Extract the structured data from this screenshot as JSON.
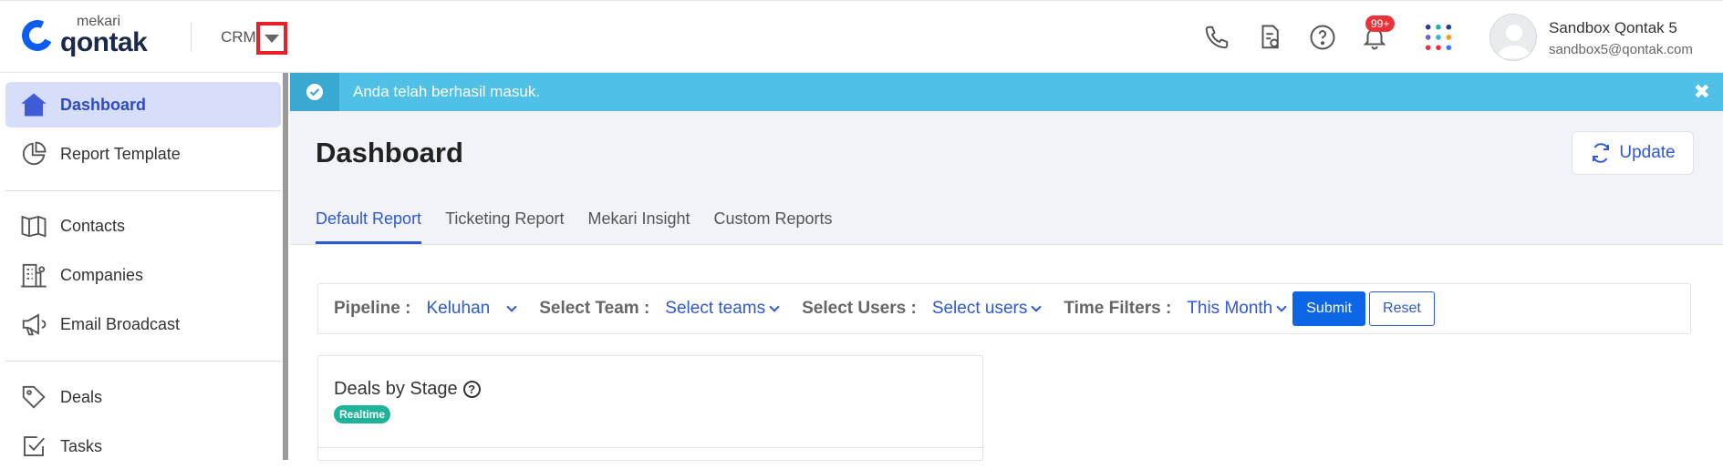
{
  "header": {
    "logo_small": "mekari",
    "logo_big": "qontak",
    "module": "CRM",
    "notification_count": "99+",
    "user_name": "Sandbox Qontak 5",
    "user_email": "sandbox5@qontak.com"
  },
  "sidebar": {
    "items": [
      {
        "label": "Dashboard",
        "icon": "home-icon",
        "active": true
      },
      {
        "label": "Report Template",
        "icon": "pie-chart-icon"
      },
      {
        "label": "Contacts",
        "icon": "book-icon"
      },
      {
        "label": "Companies",
        "icon": "building-icon"
      },
      {
        "label": "Email Broadcast",
        "icon": "megaphone-icon"
      },
      {
        "label": "Deals",
        "icon": "tag-icon"
      },
      {
        "label": "Tasks",
        "icon": "checkbox-icon"
      }
    ]
  },
  "alert": {
    "message": "Anda telah berhasil masuk.",
    "close": "✖"
  },
  "page": {
    "title": "Dashboard",
    "update_label": "Update"
  },
  "tabs": [
    "Default Report",
    "Ticketing Report",
    "Mekari Insight",
    "Custom Reports"
  ],
  "filters": {
    "pipeline_label": "Pipeline :",
    "pipeline_value": "Keluhan",
    "team_label": "Select Team :",
    "team_value": "Select teams",
    "users_label": "Select Users :",
    "users_value": "Select users",
    "time_label": "Time Filters :",
    "time_value": "This Month",
    "submit": "Submit",
    "reset": "Reset"
  },
  "card": {
    "title": "Deals by Stage",
    "help": "?",
    "badge": "Realtime"
  },
  "colors": {
    "accent": "#2d58d6",
    "alert": "#4fc0e6",
    "badge": "#1fb39a",
    "notification": "#e8333b"
  }
}
